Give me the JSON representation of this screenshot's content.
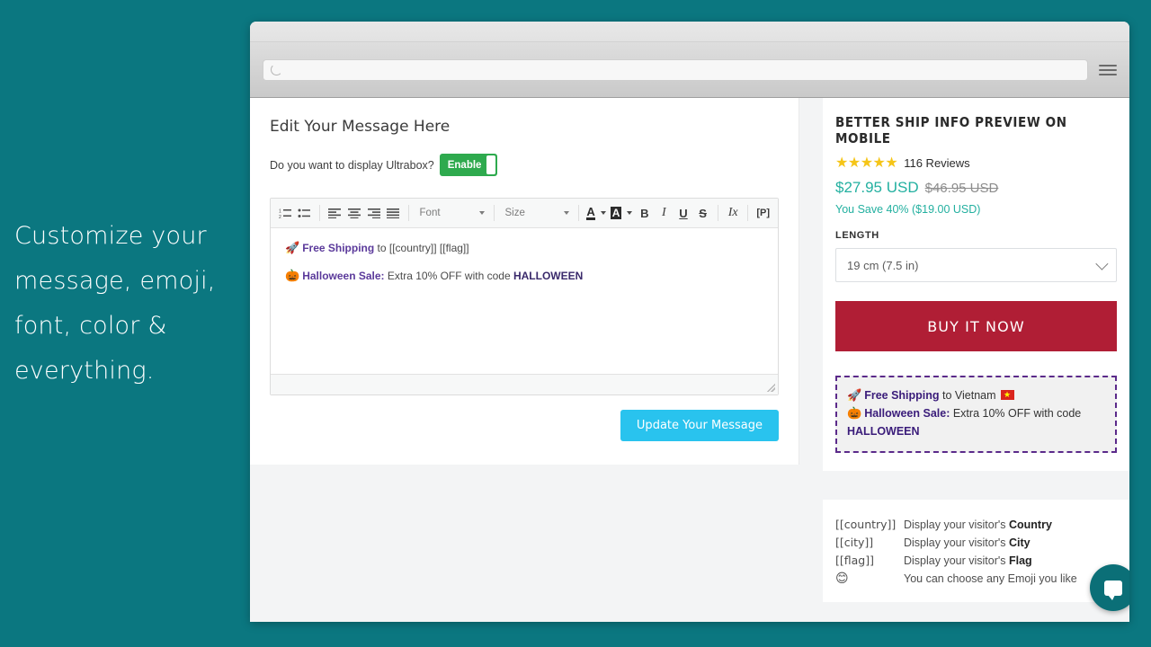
{
  "promo": {
    "caption": "Customize your message, emoji, font, color & everything."
  },
  "theme": {
    "background_teal": "#0b7780",
    "toggle_green": "#2eaa4e",
    "update_blue": "#29c3ee",
    "buy_red": "#b01e35",
    "price_teal": "#23b0a0",
    "star_gold": "#f5c518",
    "ultrabox_purple": "#5b2a8a"
  },
  "browser": {
    "address_value": "",
    "address_placeholder": "",
    "reload_icon": "reload-icon",
    "menu_icon": "hamburger-menu-icon"
  },
  "editor": {
    "title": "Edit Your Message Here",
    "toggle_question": "Do you want to display Ultrabox?",
    "toggle_state_label": "Enable",
    "update_button_label": "Update Your Message",
    "toolbar": {
      "ordered_list": "ordered-list-icon",
      "unordered_list": "unordered-list-icon",
      "align_left": "align-left-icon",
      "align_center": "align-center-icon",
      "align_right": "align-right-icon",
      "align_justify": "align-justify-icon",
      "font_label": "Font",
      "size_label": "Size",
      "text_color": "A",
      "background_color": "A",
      "bold": "B",
      "italic": "I",
      "underline": "U",
      "strikethrough": "S",
      "remove_format": "Ix",
      "paragraph": "[P]"
    },
    "content": {
      "line1": {
        "emoji": "🚀",
        "strong": "Free Shipping",
        "rest": " to [[country]] [[flag]]"
      },
      "line2": {
        "emoji": "🎃",
        "strong": "Halloween Sale:",
        "rest": " Extra 10% OFF with code ",
        "code": "HALLOWEEN"
      }
    }
  },
  "preview": {
    "product_title": "BETTER SHIP INFO PREVIEW ON MOBILE",
    "stars": "★★★★★",
    "reviews": "116 Reviews",
    "price_sale": "$27.95 USD",
    "price_compare": "$46.95 USD",
    "savings": "You Save 40% ($19.00 USD)",
    "length_label": "LENGTH",
    "length_value": "19 cm (7.5 in)",
    "buy_button_label": "BUY IT NOW",
    "ultrabox": {
      "line1": {
        "emoji": "🚀",
        "strong": "Free Shipping",
        "rest": " to Vietnam "
      },
      "line2": {
        "emoji": "🎃",
        "strong": "Halloween Sale:",
        "rest": " Extra 10% OFF with code ",
        "code": "HALLOWEEN"
      }
    }
  },
  "legend": {
    "rows": [
      {
        "token": "[[country]]",
        "prefix": "Display your visitor's ",
        "bold": "Country"
      },
      {
        "token": "[[city]]",
        "prefix": "Display your visitor's ",
        "bold": "City"
      },
      {
        "token": "[[flag]]",
        "prefix": "Display your visitor's ",
        "bold": "Flag"
      },
      {
        "token": "😊",
        "prefix": "You can choose any Emoji you like",
        "bold": ""
      }
    ]
  },
  "chat": {
    "icon": "chat-bubble-icon"
  }
}
